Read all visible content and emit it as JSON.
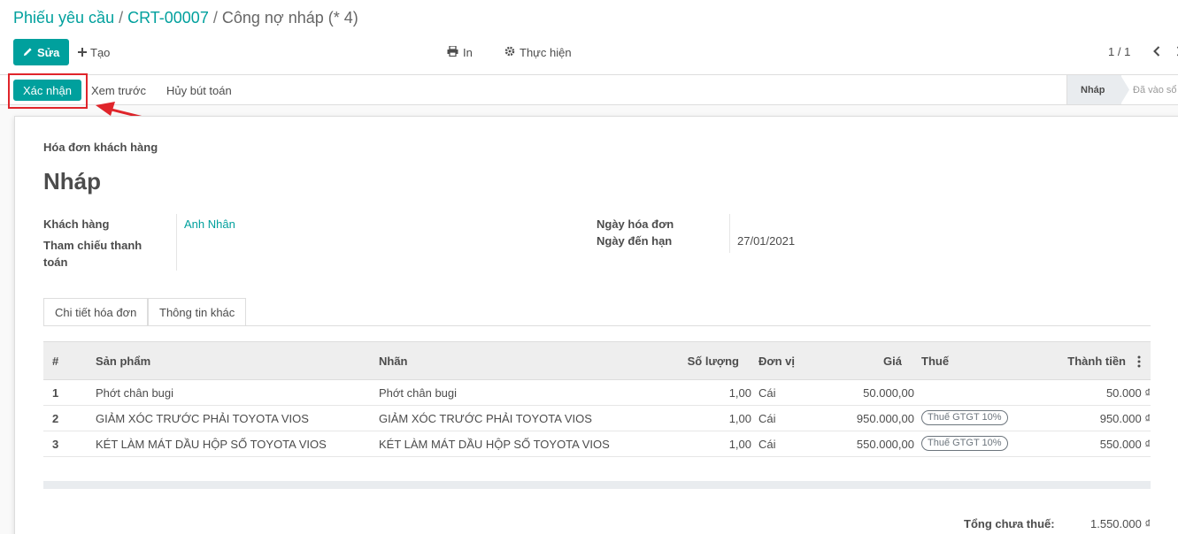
{
  "breadcrumb": {
    "items": [
      "Phiếu yêu cầu",
      "CRT-00007",
      "Công nợ nháp (* 4)"
    ],
    "separator": "/"
  },
  "toolbar": {
    "edit_label": "Sửa",
    "create_label": "Tạo",
    "print_label": "In",
    "action_label": "Thực hiện"
  },
  "pager": {
    "value": "1 / 1"
  },
  "statusbar": {
    "confirm_label": "Xác nhận",
    "preview_label": "Xem trước",
    "cancel_label": "Hủy bút toán",
    "stages": [
      "Nháp",
      "Đã vào sổ"
    ],
    "current_stage": "Nháp"
  },
  "form": {
    "doc_type": "Hóa đơn khách hàng",
    "name": "Nháp",
    "customer_label": "Khách hàng",
    "customer_value": "Anh Nhân",
    "payment_ref_label_line1": "Tham chiếu thanh",
    "payment_ref_label_line2": "toán",
    "invoice_date_label": "Ngày hóa đơn",
    "due_date_label": "Ngày đến hạn",
    "due_date_value": "27/01/2021"
  },
  "tabs": [
    "Chi tiết hóa đơn",
    "Thông tin khác"
  ],
  "table": {
    "headers": [
      "#",
      "Sản phẩm",
      "Nhãn",
      "Số lượng",
      "Đơn vị",
      "Giá",
      "Thuế",
      "Thành tiền"
    ],
    "rows": [
      {
        "num": "1",
        "product": "Phớt chân bugi",
        "label": "Phớt chân bugi",
        "qty": "1,00",
        "uom": "Cái",
        "price": "50.000,00",
        "tax": "",
        "subtotal": "50.000 ₫"
      },
      {
        "num": "2",
        "product": "GIẢM XÓC TRƯỚC PHẢI TOYOTA VIOS",
        "label": "GIẢM XÓC TRƯỚC PHẢI TOYOTA VIOS",
        "qty": "1,00",
        "uom": "Cái",
        "price": "950.000,00",
        "tax": "Thuế GTGT 10%",
        "subtotal": "950.000 ₫"
      },
      {
        "num": "3",
        "product": "KÉT LÀM MÁT DẦU HỘP SỐ TOYOTA VIOS",
        "label": "KÉT LÀM MÁT DẦU HỘP SỐ TOYOTA VIOS",
        "qty": "1,00",
        "uom": "Cái",
        "price": "550.000,00",
        "tax": "Thuế GTGT 10%",
        "subtotal": "550.000 ₫"
      }
    ]
  },
  "totals": {
    "untaxed_label": "Tổng chưa thuế:",
    "untaxed_value": "1.550.000 ₫"
  },
  "colors": {
    "primary": "#00A09D",
    "annotation": "#e0252b"
  },
  "icons": [
    "pencil-icon",
    "plus-icon",
    "print-icon",
    "gear-icon",
    "chevron-left-icon",
    "chevron-right-icon",
    "kebab-icon"
  ]
}
